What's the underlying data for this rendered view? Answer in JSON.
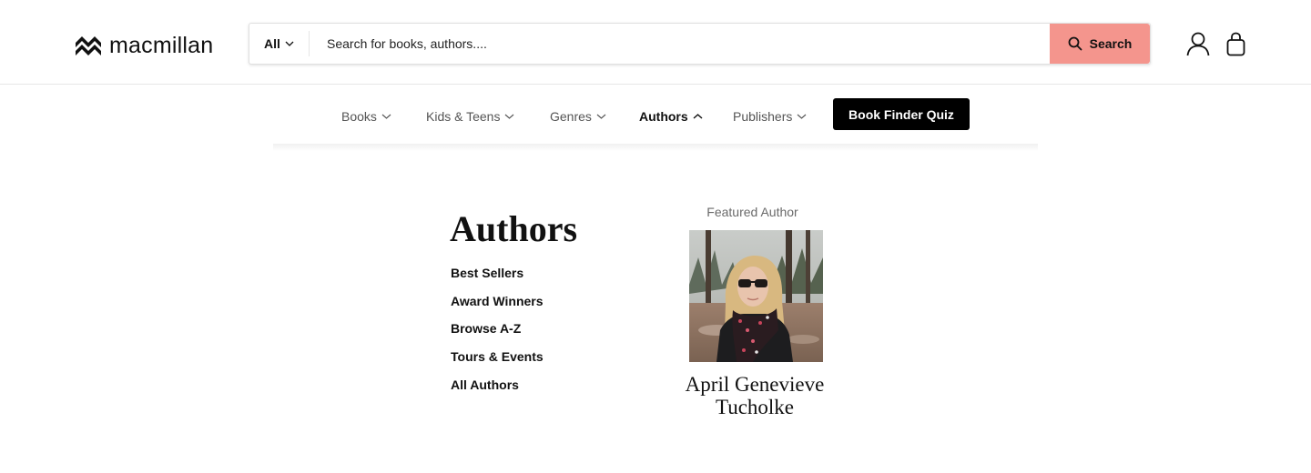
{
  "brand": {
    "name": "macmillan"
  },
  "search": {
    "scope_label": "All",
    "placeholder": "Search for books, authors....",
    "button_label": "Search",
    "button_color": "#f4958d"
  },
  "header_icons": [
    "account-icon",
    "shopping-bag-icon"
  ],
  "nav": {
    "items": [
      {
        "label": "Books",
        "state": "collapsed"
      },
      {
        "label": "Kids & Teens",
        "state": "collapsed"
      },
      {
        "label": "Genres",
        "state": "collapsed"
      },
      {
        "label": "Authors",
        "state": "expanded"
      },
      {
        "label": "Publishers",
        "state": "collapsed"
      }
    ],
    "cta_label": "Book Finder Quiz"
  },
  "dropdown": {
    "title": "Authors",
    "links": [
      {
        "label": "Best Sellers"
      },
      {
        "label": "Award Winners"
      },
      {
        "label": "Browse A-Z"
      },
      {
        "label": "Tours & Events"
      },
      {
        "label": "All Authors"
      }
    ],
    "featured": {
      "label": "Featured Author",
      "name_line1": "April Genevieve",
      "name_line2": "Tucholke"
    }
  }
}
